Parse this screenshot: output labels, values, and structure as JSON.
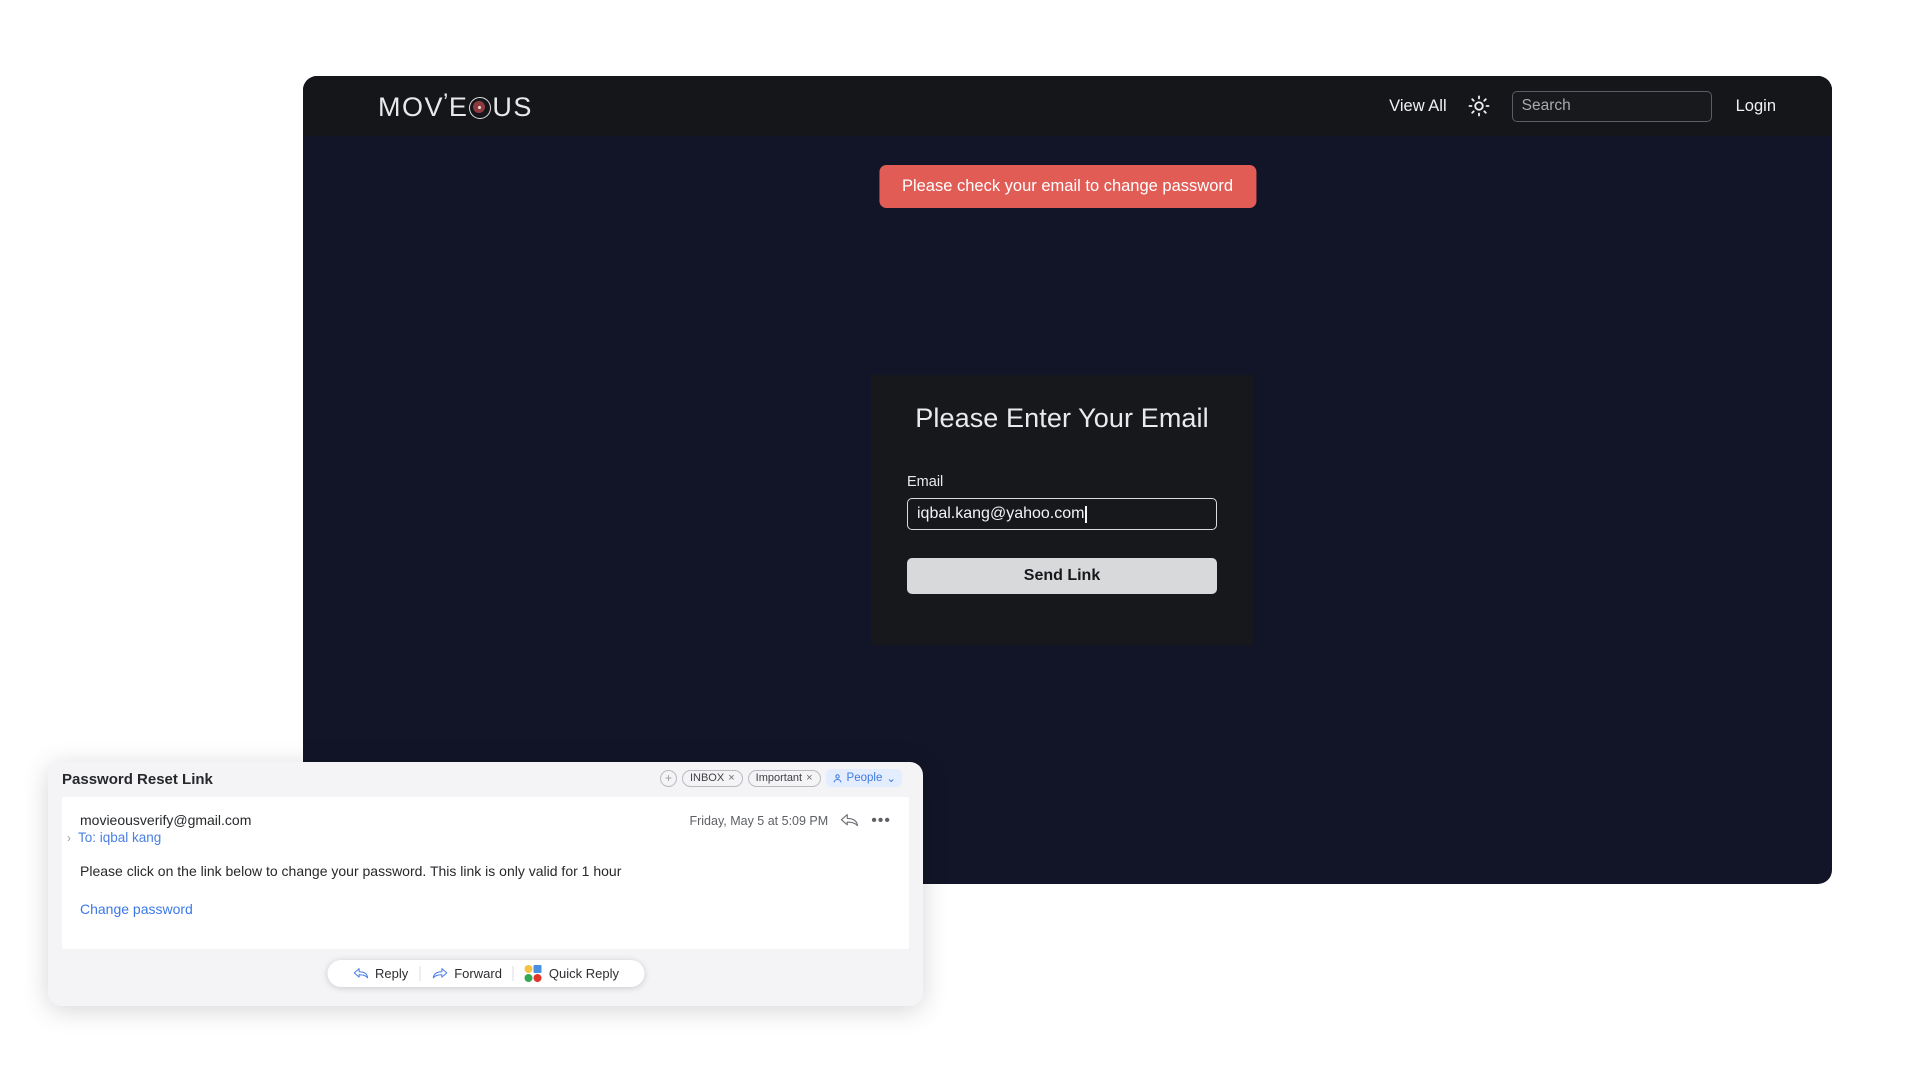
{
  "app": {
    "logo": {
      "part1": "MOV",
      "apostrophe": "’",
      "part2": "E",
      "target_icon": "target-circle-icon",
      "part3": "US",
      "accent_color": "#8e3b40"
    },
    "header": {
      "view_all_label": "View All",
      "theme_icon": "sun-icon",
      "search": {
        "placeholder": "Search",
        "value": ""
      },
      "login_label": "Login",
      "background_color": "#141619"
    },
    "alert": {
      "message": "Please check your email to change password",
      "color": "#e25c56"
    },
    "form": {
      "title": "Please Enter Your Email",
      "email_label": "Email",
      "email_value": "iqbal.kang@yahoo.com",
      "email_placeholder": "Email",
      "submit_label": "Send Link",
      "card_background": "#16181c"
    },
    "body_background": "#111527"
  },
  "mail": {
    "window_title": "Password Reset Link",
    "tags": {
      "add_label": "+",
      "items": [
        {
          "label": "INBOX",
          "close": "×"
        },
        {
          "label": "Important",
          "close": "×"
        }
      ],
      "category": {
        "icon": "person-icon",
        "label": "People",
        "chevron": "⌄"
      }
    },
    "message": {
      "sender": "movieousverify@gmail.com",
      "expand_chevron": "›",
      "recipient": "To: iqbal kang",
      "date": "Friday, May 5 at 5:09 PM",
      "reply_icon": "reply-arrow-icon",
      "more_icon": "•••",
      "body_text": "Please click on the link below to change your password. This link is only valid for 1 hour",
      "link_label": "Change password",
      "link_color": "#3b78e7"
    },
    "actions": [
      {
        "label": "Reply",
        "icon": "reply-arrow-icon"
      },
      {
        "label": "Forward",
        "icon": "forward-arrow-icon"
      },
      {
        "label": "Quick Reply",
        "icon": "emoji-cluster-icon"
      }
    ]
  }
}
